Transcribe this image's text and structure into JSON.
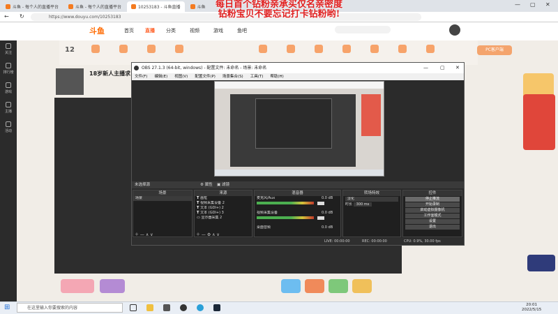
{
  "browser": {
    "tabs": [
      {
        "label": "斗鱼 - 每个人的直播平台",
        "active": false
      },
      {
        "label": "斗鱼 - 每个人的直播平台",
        "active": false
      },
      {
        "label": "10253183 - 斗鱼直播",
        "active": true
      },
      {
        "label": "斗鱼",
        "active": false
      }
    ],
    "url": "https://www.douyu.com/10253183",
    "overlay_line1": "每日首个钻粉亲承买仅名亲密度",
    "overlay_line2": "钻粉宝贝不要忘记打卡钻粉哟!"
  },
  "site": {
    "logo": "斗鱼",
    "nav": [
      "首页",
      "直播",
      "分类",
      "视频",
      "游戏",
      "鱼吧"
    ],
    "nav_active": 1,
    "streamer_title": "18岁新人主播求",
    "streamer_level": "12",
    "left_icons": [
      "关注",
      "排行榜",
      "游戏",
      "主播",
      "活动"
    ],
    "right_ad_label": "PC客户端"
  },
  "obs": {
    "title": "OBS 27.1.3 (64-bit, windows) - 配置文件: 未命名 - 场景: 未命名",
    "menu": [
      "文件(F)",
      "编辑(E)",
      "视图(V)",
      "配置文件(P)",
      "场景集合(S)",
      "工具(T)",
      "帮助(H)"
    ],
    "source_bar": "未选择源",
    "source_bar_buttons": [
      "属性",
      "滤镜"
    ],
    "panels": {
      "scenes": {
        "title": "场景",
        "items": [
          "场景"
        ]
      },
      "sources": {
        "title": "来源",
        "items": [
          "画框",
          "视频采集设备 2",
          "文本 (GDI+) 2",
          "文本 (GDI+) 3",
          "显示器采集 2"
        ]
      },
      "mixer": {
        "title": "混音器",
        "tracks": [
          {
            "name": "麦克风/Aux",
            "db": "0.0 dB"
          },
          {
            "name": "视频采集设备",
            "db": "0.0 dB"
          },
          {
            "name": "桌面音频",
            "db": "0.0 dB"
          }
        ]
      },
      "transitions": {
        "title": "转场特效",
        "type": "淡化",
        "duration_label": "时长",
        "duration": "300 ms"
      },
      "controls": {
        "title": "控件",
        "buttons": [
          "停止推流",
          "开始录制",
          "启动虚拟摄像机",
          "工作室模式",
          "设置",
          "退出"
        ]
      }
    },
    "status": {
      "live": "LIVE: 00:00:00",
      "rec": "REC: 00:00:00",
      "cpu": "CPU: 0.9%, 30.00 fps"
    }
  },
  "taskbar": {
    "search_placeholder": "在这里输入你要搜索的内容",
    "time": "20:01",
    "date": "2022/5/15"
  },
  "colors": {
    "accent": "#ff5d23",
    "overlay_text": "#e02020",
    "obs_bg": "#2b2b2b"
  }
}
